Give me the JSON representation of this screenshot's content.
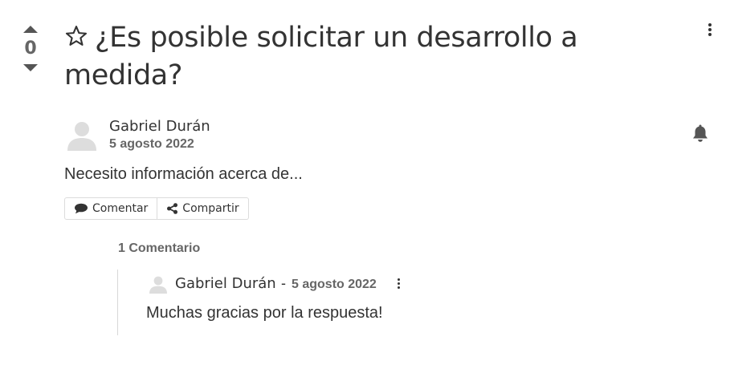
{
  "question": {
    "vote_count": "0",
    "title": "¿Es posible solicitar un desarrollo a medida?",
    "author": "Gabriel Durán",
    "date": "5 agosto 2022",
    "body": "Necesito información acerca de...",
    "actions": {
      "comment_label": "Comentar",
      "share_label": "Compartir"
    }
  },
  "comments": {
    "count_label": "1 Comentario",
    "items": [
      {
        "author": "Gabriel Durán",
        "separator": "-",
        "date": "5 agosto 2022",
        "text": "Muchas gracias por la respuesta!"
      }
    ]
  },
  "icons": {
    "vote_up": "caret-up-icon",
    "vote_down": "caret-down-icon",
    "favorite": "star-outline-icon",
    "menu": "kebab-menu-icon",
    "subscribe": "bell-icon",
    "comment": "speech-bubble-icon",
    "share": "share-nodes-icon",
    "avatar": "default-user-avatar"
  },
  "colors": {
    "text": "#333333",
    "muted": "#666666",
    "border": "#dcdcdc",
    "avatar": "#dddddd"
  }
}
